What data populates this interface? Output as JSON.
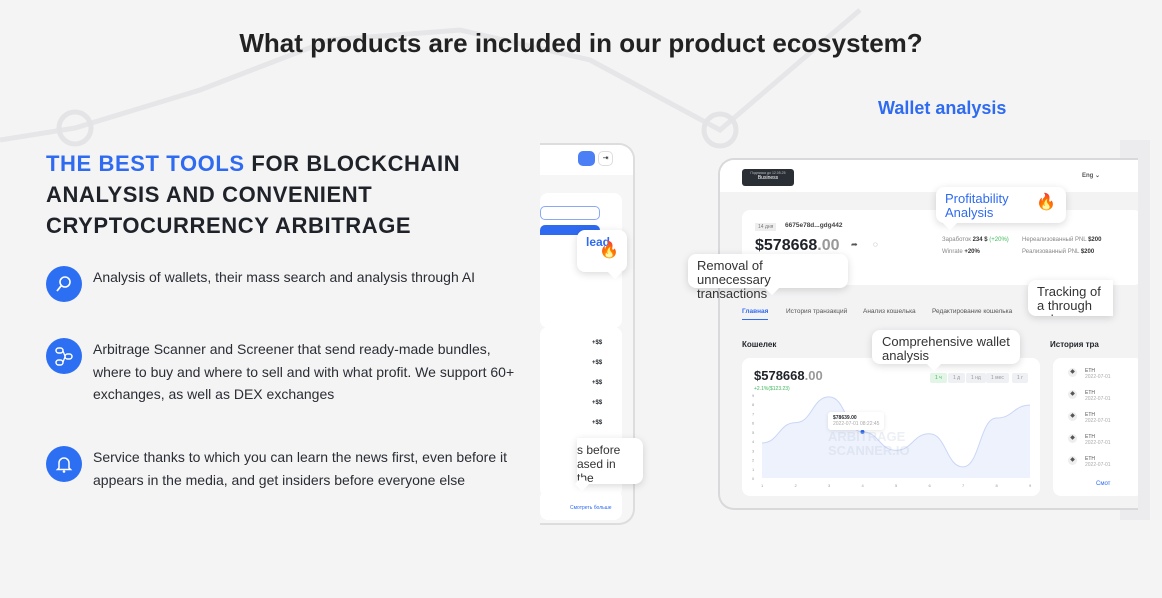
{
  "title": "What products are included in our product ecosystem?",
  "wallet_analysis_label": "Wallet analysis",
  "headline": {
    "accent": "THE BEST TOOLS",
    "rest": " FOR BLOCKCHAIN ANALYSIS AND CONVENIENT CRYPTOCURRENCY ARBITRAGE"
  },
  "features": [
    {
      "icon": "wallet-search-icon",
      "text": "Analysis of wallets, their mass search and analysis through AI"
    },
    {
      "icon": "arbitrage-nodes-icon",
      "text": "Arbitrage Scanner and Screener that send ready-made bundles, where to buy and where to sell and with what profit. We support 60+ exchanges, as well as DEX exchanges"
    },
    {
      "icon": "bell-icon",
      "text": "Service thanks to which you can learn the news first, even before it appears in the media, and get insiders before everyone else"
    }
  ],
  "phone": {
    "bubble1": "lead",
    "bubble2a": "s before",
    "bubble2b": "ased in the",
    "values": [
      "+$$",
      "+$$",
      "+$$",
      "+$$",
      "+$$"
    ],
    "more": "Смотреть больше"
  },
  "dashboard": {
    "plan_small": "Подписка до 12.05.25",
    "plan": "Business",
    "lang": "Eng",
    "days": "14 дня",
    "address": "6675e78d...gdg442",
    "balance_main": "$578668",
    "balance_dec": ".00",
    "stats": [
      {
        "label": "Заработок",
        "value": "234 $",
        "extra": "(+20%)"
      },
      {
        "label": "Winrate",
        "value": "+20%"
      },
      {
        "label": "Нереализованный PNL",
        "value": "$200"
      },
      {
        "label": "Реализованный PNL",
        "value": "$200"
      }
    ],
    "tabs": [
      "Главная",
      "История транзакций",
      "Анализ кошелька",
      "Редактирование кошелька"
    ],
    "wallet_title": "Кошелек",
    "history_title": "История тра",
    "change": "+2.1%($123.23)",
    "timeframes": [
      "1 ч",
      "1 д",
      "1 нд",
      "1 мес",
      "1 г"
    ],
    "tooltip_value": "$78639.00",
    "tooltip_date": "2022-07-01  08:22:45",
    "watermark": "ARBITRAGE SCANNER.IO",
    "history": [
      {
        "coin": "ETH",
        "date": "2022-07-01"
      },
      {
        "coin": "ETH",
        "date": "2022-07-01"
      },
      {
        "coin": "ETH",
        "date": "2022-07-01"
      },
      {
        "coin": "ETH",
        "date": "2022-07-01"
      },
      {
        "coin": "ETH",
        "date": "2022-07-01"
      }
    ],
    "history_more": "Смот"
  },
  "bubbles": {
    "profit": "Profitability Analysis",
    "removal": "Removal of unnecessary transactions",
    "tracking": "Tracking of a through Tele",
    "comprehensive": "Comprehensive wallet analysis"
  },
  "chart_data": {
    "type": "area",
    "x": [
      1,
      2,
      3,
      4,
      5,
      6,
      7,
      8,
      9
    ],
    "values": [
      3.8,
      6,
      8.8,
      5,
      3,
      4.8,
      1.2,
      6.5,
      7.9
    ],
    "ylim": [
      0,
      9
    ],
    "yticks": [
      0,
      1,
      2,
      3,
      4,
      5,
      6,
      7,
      8,
      9
    ]
  },
  "colors": {
    "accent": "#2f6bf0",
    "positive": "#3cb95a"
  }
}
